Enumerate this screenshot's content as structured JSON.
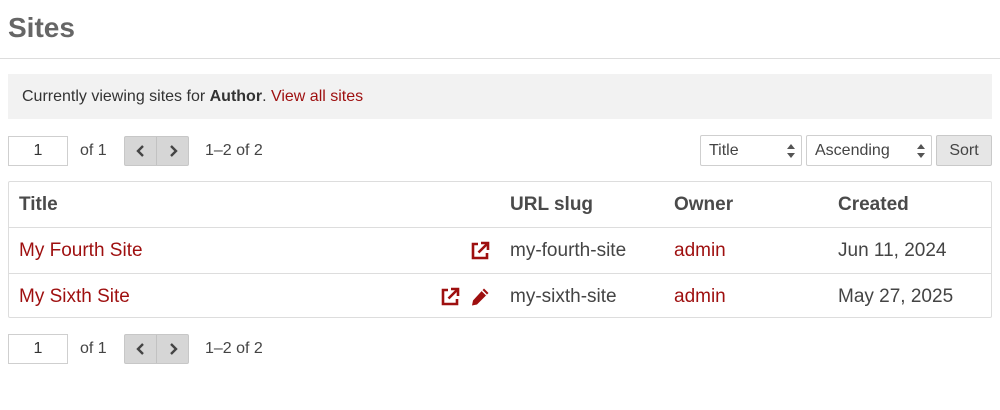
{
  "page": {
    "title": "Sites"
  },
  "notice": {
    "prefix": "Currently viewing sites for ",
    "role": "Author",
    "separator": ". ",
    "link_label": "View all sites"
  },
  "pagination": {
    "page_value": "1",
    "of_label": "of 1",
    "range_label": "1–2 of 2",
    "prev_icon": "chevron-left-icon",
    "next_icon": "chevron-right-icon"
  },
  "sort": {
    "field_value": "Title",
    "direction_value": "Ascending",
    "button_label": "Sort"
  },
  "table": {
    "headers": {
      "title": "Title",
      "slug": "URL slug",
      "owner": "Owner",
      "created": "Created"
    },
    "rows": [
      {
        "title": "My Fourth Site",
        "slug": "my-fourth-site",
        "owner": "admin",
        "created": "Jun 11, 2024",
        "icons": [
          "external-link-icon"
        ]
      },
      {
        "title": "My Sixth Site",
        "slug": "my-sixth-site",
        "owner": "admin",
        "created": "May 27, 2025",
        "icons": [
          "external-link-icon",
          "pencil-icon"
        ]
      }
    ]
  },
  "colors": {
    "accent": "#9e0f0f",
    "notice_bg": "#f2f2f2",
    "border": "#dddddd"
  }
}
